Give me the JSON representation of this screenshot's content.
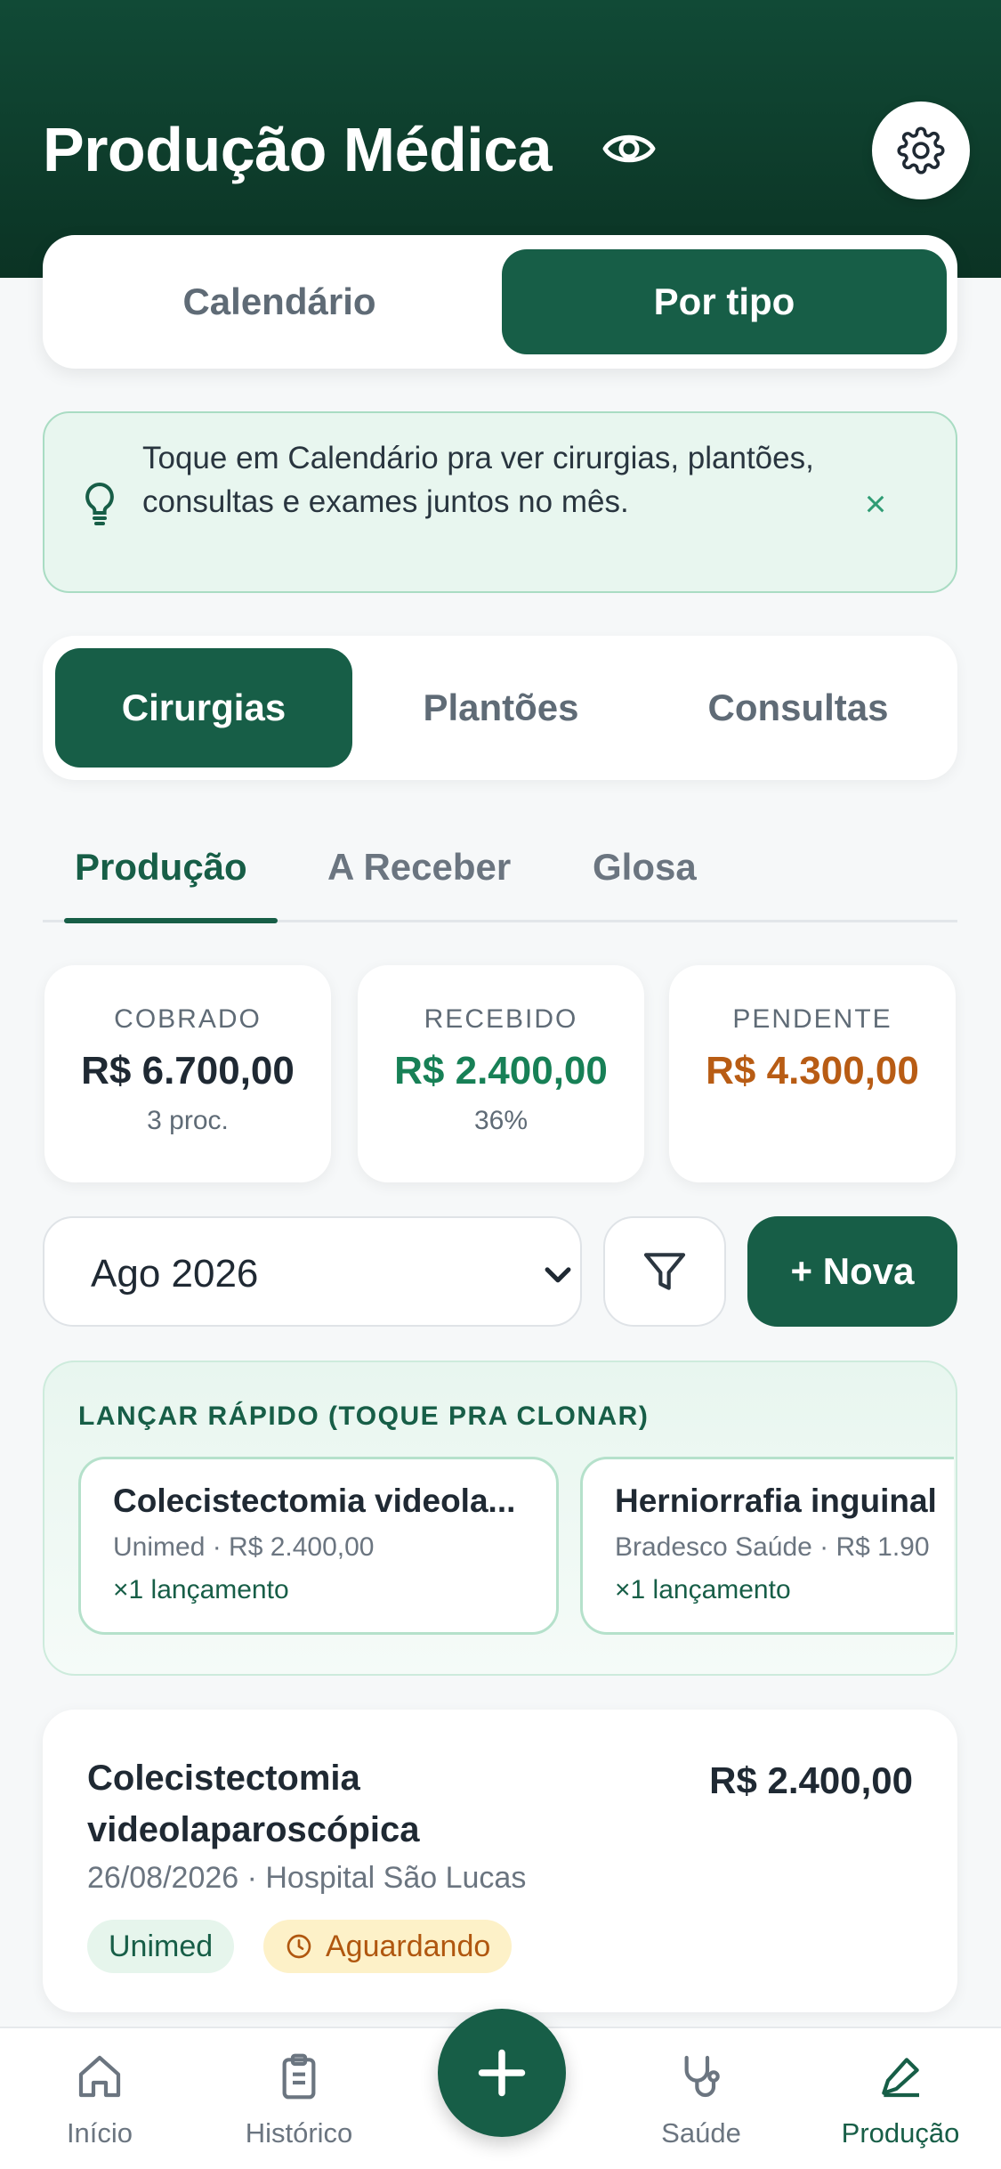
{
  "header": {
    "title": "Produção Médica",
    "icons": {
      "visibility": "eye-icon",
      "settings": "gear-icon"
    }
  },
  "view_toggle": {
    "calendar": "Calendário",
    "by_type": "Por tipo",
    "selected": "Por tipo"
  },
  "tip": {
    "text": "Toque em Calendário pra ver cirurgias, plantões, consultas e exames juntos no mês.",
    "close": "×",
    "icon": "lightbulb-icon"
  },
  "categories": {
    "items": [
      "Cirurgias",
      "Plantões",
      "Consultas"
    ],
    "selected": "Cirurgias"
  },
  "subtabs": {
    "items": [
      "Produção",
      "A Receber",
      "Glosa"
    ],
    "selected": "Produção"
  },
  "stats": [
    {
      "label": "COBRADO",
      "value": "R$ 6.700,00",
      "sub": "3 proc."
    },
    {
      "label": "RECEBIDO",
      "value": "R$ 2.400,00",
      "sub": "36%"
    },
    {
      "label": "PENDENTE",
      "value": "R$ 4.300,00",
      "sub": ""
    }
  ],
  "filters": {
    "month": "Ago 2026",
    "new_button": "+ Nova",
    "filter_icon": "filter-icon"
  },
  "quick_launch": {
    "title": "LANÇAR RÁPIDO (TOQUE PRA CLONAR)",
    "cards": [
      {
        "name": "Colecistectomia videola...",
        "meta": "Unimed · R$ 2.400,00",
        "count": "×1 lançamento"
      },
      {
        "name": "Herniorrafia inguinal",
        "meta": "Bradesco Saúde · R$ 1.90",
        "count": "×1 lançamento"
      }
    ]
  },
  "procedure": {
    "name": "Colecistectomia videolaparoscópica",
    "value": "R$ 2.400,00",
    "details": "26/08/2026 · Hospital São Lucas",
    "insurer": "Unimed",
    "status": "Aguardando"
  },
  "tabbar": {
    "items": [
      "Início",
      "Histórico",
      "Saúde",
      "Produção"
    ],
    "active": "Produção"
  },
  "colors": {
    "primary": "#175e47",
    "received": "#178056",
    "pending": "#b85c14",
    "header": "#114a36"
  }
}
